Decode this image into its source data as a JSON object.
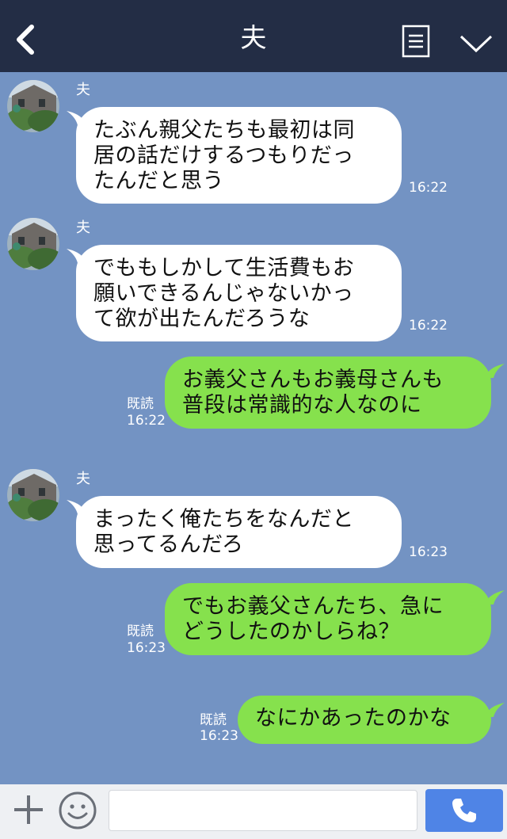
{
  "header": {
    "title": "夫"
  },
  "messages": [
    {
      "sender": "夫",
      "text": "たぶん親父たちも最初は同\n居の話だけするつもりだっ\nたんだと思う",
      "time": "16:22"
    },
    {
      "sender": "夫",
      "text": "でももしかして生活費もお\n願いできるんじゃないかっ\nて欲が出たんだろうな",
      "time": "16:22"
    },
    {
      "text": "お義父さんもお義母さんも\n普段は常識的な人なのに",
      "read": "既読",
      "time": "16:22"
    },
    {
      "sender": "夫",
      "text": "まったく俺たちをなんだと\n思ってるんだろ",
      "time": "16:23"
    },
    {
      "text": "でもお義父さんたち、急に\nどうしたのかしらね？",
      "read": "既読",
      "time": "16:23"
    },
    {
      "text": "なにかあったのかな",
      "read": "既読",
      "time": "16:23"
    }
  ],
  "icons": {
    "back": "back-chevron-icon",
    "menu": "menu-list-icon",
    "collapse": "chevron-down-icon",
    "add": "plus-icon",
    "sticker": "smiley-icon",
    "call": "phone-icon"
  },
  "colors": {
    "header_bg": "#232d45",
    "chat_bg": "#7393c3",
    "incoming_bubble": "#ffffff",
    "outgoing_bubble": "#86e14d",
    "call_button": "#4f84e6"
  }
}
